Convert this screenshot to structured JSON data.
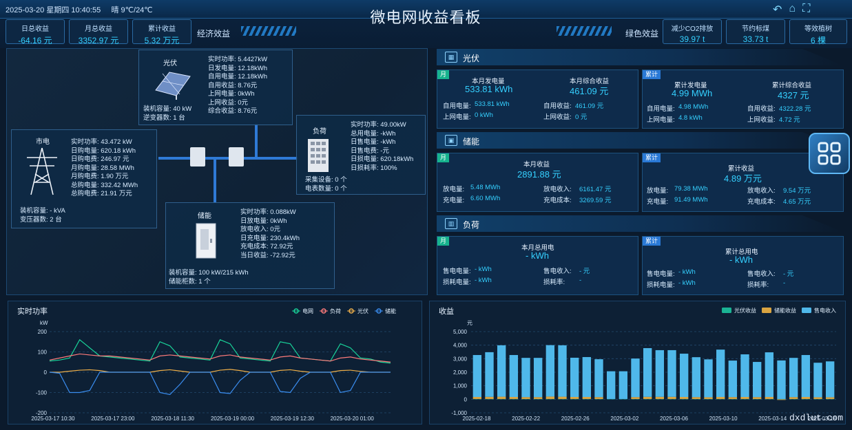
{
  "header": {
    "datetime": "2025-03-20 星期四 10:40:55",
    "weather": "晴  9℃/24℃",
    "title": "微电网收益看板"
  },
  "econ": {
    "label": "经济效益",
    "kpis": [
      {
        "label": "日总收益",
        "value": "-64.16 元"
      },
      {
        "label": "月总收益",
        "value": "3352.97 元"
      },
      {
        "label": "累计收益",
        "value": "5.32 万元"
      }
    ]
  },
  "green": {
    "label": "绿色效益",
    "kpis": [
      {
        "label": "减少CO2排放",
        "value": "39.97 t"
      },
      {
        "label": "节约标煤",
        "value": "33.73 t"
      },
      {
        "label": "等效植树",
        "value": "6 棵"
      }
    ]
  },
  "pv_node": {
    "title": "光伏",
    "rows": [
      "实时功率: 5.4427kW",
      "日发电量: 12.18kWh",
      "自用电量: 12.18kWh",
      "自用收益: 8.76元",
      "上网电量: 0kWh",
      "上网收益: 0元",
      "综合收益: 8.76元"
    ],
    "info": [
      "装机容量: 40 kW",
      "逆变器数: 1 台"
    ]
  },
  "grid_node": {
    "title": "市电",
    "rows": [
      "实时功率: 43.472 kW",
      "日购电量: 620.18 kWh",
      "日购电费: 246.97 元",
      "月购电量: 28.58 MWh",
      "月购电费: 1.90 万元",
      "总购电量: 332.42 MWh",
      "总购电费: 21.91 万元"
    ],
    "info": [
      "装机容量: - kVA",
      "变压器数: 2 台"
    ]
  },
  "load_node": {
    "title": "负荷",
    "rows": [
      "实时功率: 49.00kW",
      "总用电量: -kWh",
      "日售电量: -kWh",
      "日售电费: -元",
      "日损电量: 620.18kWh",
      "日损耗率: 100%"
    ],
    "info": [
      "采集设备: 0 个",
      "电表数量: 0 个"
    ]
  },
  "storage_node": {
    "title": "储能",
    "rows": [
      "实时功率: 0.088kW",
      "日放电量: 0kWh",
      "放电收入: 0元",
      "日充电量: 230.4kWh",
      "充电成本: 72.92元",
      "当日收益: -72.92元"
    ],
    "info": [
      "装机容量: 100 kW/215 kWh",
      "储能柜数: 1 个"
    ]
  },
  "pv_section": {
    "title": "光伏",
    "month_tag": "月",
    "total_tag": "累计",
    "month": {
      "main": [
        {
          "label": "本月发电量",
          "value": "533.81 kWh"
        },
        {
          "label": "本月综合收益",
          "value": "461.09 元"
        }
      ],
      "rows": [
        [
          "自用电量:",
          "533.81 kWh",
          "自用收益:",
          "461.09 元"
        ],
        [
          "上网电量:",
          "0 kWh",
          "上网收益:",
          "0 元"
        ]
      ]
    },
    "total": {
      "main": [
        {
          "label": "累计发电量",
          "value": "4.99 MWh"
        },
        {
          "label": "累计综合收益",
          "value": "4327 元"
        }
      ],
      "rows": [
        [
          "自用电量:",
          "4.98 MWh",
          "自用收益:",
          "4322.28 元"
        ],
        [
          "上网电量:",
          "4.8 kWh",
          "上网收益:",
          "4.72 元"
        ]
      ]
    }
  },
  "storage_section": {
    "title": "储能",
    "month_tag": "月",
    "total_tag": "累计",
    "month": {
      "main": [
        {
          "label": "本月收益",
          "value": "2891.88 元"
        }
      ],
      "rows": [
        [
          "放电量:",
          "5.48 MWh",
          "放电收入:",
          "6161.47 元"
        ],
        [
          "充电量:",
          "6.60 MWh",
          "充电成本:",
          "3269.59 元"
        ]
      ]
    },
    "total": {
      "main": [
        {
          "label": "累计收益",
          "value": "4.89 万元"
        }
      ],
      "rows": [
        [
          "放电量:",
          "79.38 MWh",
          "放电收入:",
          "9.54 万元"
        ],
        [
          "充电量:",
          "91.49 MWh",
          "充电成本:",
          "4.65 万元"
        ]
      ]
    }
  },
  "load_section": {
    "title": "负荷",
    "month_tag": "月",
    "total_tag": "累计",
    "month": {
      "main": [
        {
          "label": "本月总用电",
          "value": "- kWh"
        }
      ],
      "rows": [
        [
          "售电电量:",
          "- kWh",
          "售电收入:",
          "- 元"
        ],
        [
          "损耗电量:",
          "- kWh",
          "损耗率:",
          "-"
        ]
      ]
    },
    "total": {
      "main": [
        {
          "label": "累计总用电",
          "value": "- kWh"
        }
      ],
      "rows": [
        [
          "售电电量:",
          "- kWh",
          "售电收入:",
          "- 元"
        ],
        [
          "损耗电量:",
          "- kWh",
          "损耗率:",
          "-"
        ]
      ]
    }
  },
  "watermark": "dxdlut.com",
  "chart_data": [
    {
      "type": "line",
      "title": "实时功率",
      "ylabel": "kW",
      "ylim": [
        -200,
        200
      ],
      "yticks": [
        200,
        100,
        0,
        -100,
        -200
      ],
      "xticks": [
        "2025-03-17 10:30",
        "2025-03-17 23:00",
        "2025-03-18 11:30",
        "2025-03-19 00:00",
        "2025-03-19 12:30",
        "2025-03-20 01:00"
      ],
      "grid": true,
      "legend": "top-right",
      "series": [
        {
          "name": "电网",
          "color": "#19d49a",
          "values": [
            55,
            60,
            70,
            160,
            120,
            80,
            75,
            70,
            65,
            60,
            55,
            150,
            130,
            75,
            70,
            65,
            60,
            160,
            140,
            70,
            65,
            60,
            55,
            150,
            140,
            70,
            65,
            60,
            55,
            140,
            120,
            70,
            65,
            50,
            45
          ]
        },
        {
          "name": "负荷",
          "color": "#ff7b7b",
          "values": [
            60,
            70,
            80,
            90,
            85,
            80,
            80,
            75,
            70,
            65,
            60,
            80,
            85,
            80,
            75,
            70,
            65,
            80,
            85,
            75,
            70,
            65,
            60,
            75,
            80,
            70,
            65,
            60,
            55,
            70,
            75,
            65,
            60,
            55,
            50
          ]
        },
        {
          "name": "光伏",
          "color": "#f0b04a",
          "values": [
            0,
            0,
            5,
            10,
            12,
            8,
            0,
            0,
            0,
            0,
            0,
            8,
            12,
            6,
            0,
            0,
            0,
            10,
            14,
            8,
            0,
            0,
            0,
            9,
            12,
            5,
            0,
            0,
            0,
            8,
            10,
            4,
            0,
            0,
            0
          ]
        },
        {
          "name": "储能",
          "color": "#3a8df0",
          "values": [
            0,
            -5,
            -100,
            -100,
            -90,
            0,
            0,
            0,
            0,
            0,
            0,
            -100,
            -110,
            -60,
            0,
            0,
            0,
            -100,
            -105,
            -40,
            0,
            0,
            0,
            -95,
            -100,
            -30,
            0,
            0,
            0,
            -100,
            -90,
            0,
            0,
            0,
            0
          ]
        }
      ]
    },
    {
      "type": "bar",
      "title": "收益",
      "ylabel": "元",
      "ylim": [
        -1000,
        5000
      ],
      "yticks": [
        "5,000",
        "4,000",
        "3,000",
        "2,000",
        "1,000",
        "0",
        "-1,000"
      ],
      "xticks": [
        "2025-02-18",
        "2025-02-22",
        "2025-02-26",
        "2025-03-02",
        "2025-03-06",
        "2025-03-10",
        "2025-03-14",
        "2025-03-18"
      ],
      "legend": "top-right",
      "series": [
        {
          "name": "光伏收益",
          "color": "#1ab394",
          "values": [
            20,
            20,
            20,
            20,
            20,
            20,
            20,
            20,
            20,
            20,
            20,
            20,
            20,
            20,
            20,
            20,
            20,
            20,
            20,
            20,
            20,
            20,
            20,
            20,
            20,
            20,
            20,
            20,
            20,
            20
          ]
        },
        {
          "name": "储能收益",
          "color": "#d9a441",
          "values": [
            150,
            160,
            170,
            150,
            140,
            140,
            180,
            170,
            150,
            150,
            140,
            0,
            0,
            140,
            160,
            160,
            160,
            150,
            140,
            130,
            150,
            140,
            150,
            140,
            150,
            -50,
            140,
            150,
            130,
            130
          ]
        },
        {
          "name": "售电收入",
          "color": "#4fb8ea",
          "values": [
            3100,
            3300,
            3800,
            3100,
            2900,
            2900,
            3800,
            3800,
            2900,
            2950,
            2800,
            2050,
            2050,
            2850,
            3600,
            3450,
            3450,
            3200,
            2950,
            2800,
            3500,
            2700,
            3150,
            2600,
            3300,
            2850,
            2900,
            3100,
            2550,
            2650
          ]
        }
      ]
    }
  ]
}
